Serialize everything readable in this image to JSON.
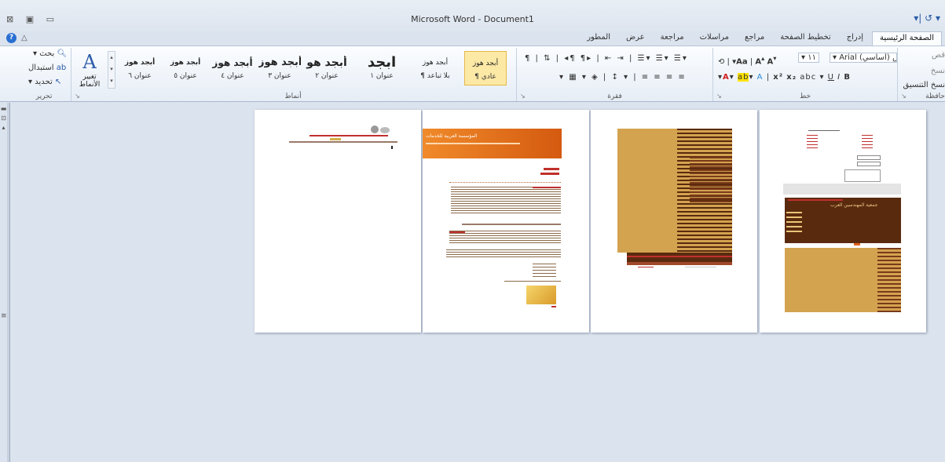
{
  "window": {
    "title": "Microsoft Word - Document1",
    "left_controls": "⊠ ▣ ▭",
    "quick_access": "▾| ↺ ▾"
  },
  "tabs": [
    "الصفحة الرئيسية",
    "إدراج",
    "تخطيط الصفحة",
    "مراجع",
    "مراسلات",
    "مراجعة",
    "عرض",
    "المطور"
  ],
  "active_tab": 0,
  "ribbon": {
    "clipboard": {
      "label": "حافظة",
      "cut": "قص",
      "copy": "نسخ",
      "format_painter": "نسخ التنسيق"
    },
    "font": {
      "label": "خط",
      "font_name": "Arial (أساسي) بس",
      "font_size": "١١",
      "grow": "A",
      "shrink": "A",
      "change_case": "Aa"
    },
    "paragraph": {
      "label": "فقرة"
    },
    "styles": {
      "label": "أنماط",
      "items": [
        {
          "preview": "أبجد هوز",
          "name": "¶ عادي",
          "selected": true
        },
        {
          "preview": "أبجد هوز",
          "name": "¶ بلا تباعد",
          "selected": false
        },
        {
          "preview": "أبجد",
          "name": "عنوان ١",
          "selected": false
        },
        {
          "preview": "أبجد هو",
          "name": "عنوان ٢",
          "selected": false
        },
        {
          "preview": "أبجد هوز",
          "name": "عنوان ٣",
          "selected": false
        },
        {
          "preview": "أبجد هوز",
          "name": "عنوان ٤",
          "selected": false
        },
        {
          "preview": "أبجد هوز",
          "name": "عنوان ٥",
          "selected": false
        },
        {
          "preview": "أبجد هوز",
          "name": "عنوان ٦",
          "selected": false
        }
      ],
      "change_styles": "تغيير الأنماط"
    },
    "editing": {
      "label": "تحرير",
      "find": "بحث",
      "replace": "استبدال",
      "select": "تحديد"
    }
  },
  "pages": [
    {
      "title": "المؤسسة العربية للخدمات"
    },
    {},
    {},
    {
      "footer_text": "جمعية المهندسين العرب"
    }
  ],
  "colors": {
    "accent": "#2a5ba8",
    "orange": "#e0621a",
    "tan": "#d3a350",
    "brown": "#5a2a0e"
  }
}
